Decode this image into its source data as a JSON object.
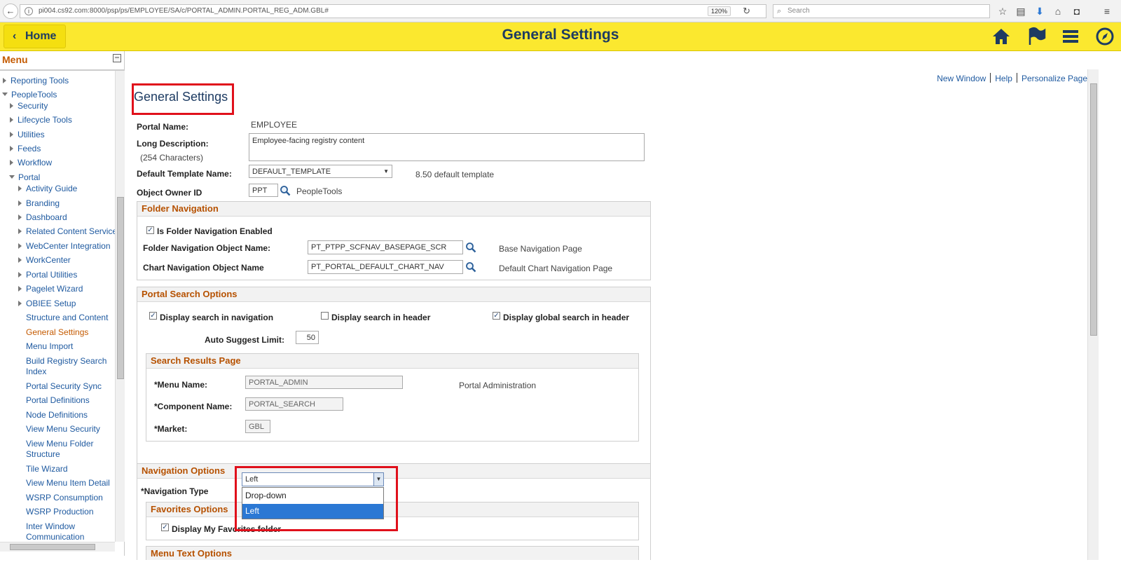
{
  "browser": {
    "url": "pi004.cs92.com:8000/psp/ps/EMPLOYEE/SA/c/PORTAL_ADMIN.PORTAL_REG_ADM.GBL#",
    "zoom": "120%",
    "search_placeholder": "Search"
  },
  "header": {
    "home_label": "Home",
    "title": "General Settings"
  },
  "menu": {
    "title": "Menu",
    "items": [
      {
        "label": "Reporting Tools"
      },
      {
        "label": "PeopleTools"
      },
      {
        "label": "Security"
      },
      {
        "label": "Lifecycle Tools"
      },
      {
        "label": "Utilities"
      },
      {
        "label": "Feeds"
      },
      {
        "label": "Workflow"
      },
      {
        "label": "Portal"
      },
      {
        "label": "Activity Guide"
      },
      {
        "label": "Branding"
      },
      {
        "label": "Dashboard"
      },
      {
        "label": "Related Content Service"
      },
      {
        "label": "WebCenter Integration"
      },
      {
        "label": "WorkCenter"
      },
      {
        "label": "Portal Utilities"
      },
      {
        "label": "Pagelet Wizard"
      },
      {
        "label": "OBIEE Setup"
      },
      {
        "label": "Structure and Content"
      },
      {
        "label": "General Settings"
      },
      {
        "label": "Menu Import"
      },
      {
        "label": "Build Registry Search"
      },
      {
        "label": "Index"
      },
      {
        "label": "Portal Security Sync"
      },
      {
        "label": "Portal Definitions"
      },
      {
        "label": "Node Definitions"
      },
      {
        "label": "View Menu Security"
      },
      {
        "label": "View Menu Folder"
      },
      {
        "label": "Structure"
      },
      {
        "label": "Tile Wizard"
      },
      {
        "label": "View Menu Item Detail"
      },
      {
        "label": "WSRP Consumption"
      },
      {
        "label": "WSRP Production"
      },
      {
        "label": "Inter Window"
      },
      {
        "label": "Communication"
      }
    ]
  },
  "links": {
    "new_window": "New Window",
    "help": "Help",
    "personalize": "Personalize Page"
  },
  "page": {
    "title": "General Settings",
    "portal_name_label": "Portal Name:",
    "portal_name_value": "EMPLOYEE",
    "long_desc_label": "Long Description:",
    "long_desc_hint": "(254 Characters)",
    "long_desc_value": "Employee-facing registry content",
    "template_label": "Default Template Name:",
    "template_value": "DEFAULT_TEMPLATE",
    "template_desc": "8.50 default template",
    "owner_label": "Object Owner ID",
    "owner_value": "PPT",
    "owner_desc": "PeopleTools"
  },
  "folder_nav": {
    "title": "Folder Navigation",
    "enabled_label": "Is Folder Navigation Enabled",
    "obj_name_label": "Folder Navigation Object Name:",
    "obj_name_value": "PT_PTPP_SCFNAV_BASEPAGE_SCR",
    "obj_name_desc": "Base Navigation Page",
    "chart_label": "Chart Navigation Object Name",
    "chart_value": "PT_PORTAL_DEFAULT_CHART_NAV",
    "chart_desc": "Default Chart Navigation Page"
  },
  "search_opts": {
    "title": "Portal Search Options",
    "nav_label": "Display search in navigation",
    "header_label": "Display search in header",
    "global_label": "Display global search in header",
    "limit_label": "Auto Suggest Limit:",
    "limit_value": "50"
  },
  "results_page": {
    "title": "Search Results Page",
    "menu_label": "*Menu Name:",
    "menu_value": "PORTAL_ADMIN",
    "menu_desc": "Portal Administration",
    "comp_label": "*Component Name:",
    "comp_value": "PORTAL_SEARCH",
    "market_label": "*Market:",
    "market_value": "GBL"
  },
  "nav_opts": {
    "title": "Navigation Options",
    "type_label": "*Navigation Type",
    "type_value": "Left",
    "options": [
      "Drop-down",
      "Left"
    ]
  },
  "fav_opts": {
    "title": "Favorites Options",
    "display_label": "Display My Favorites folder"
  },
  "menu_text": {
    "title": "Menu Text Options"
  }
}
